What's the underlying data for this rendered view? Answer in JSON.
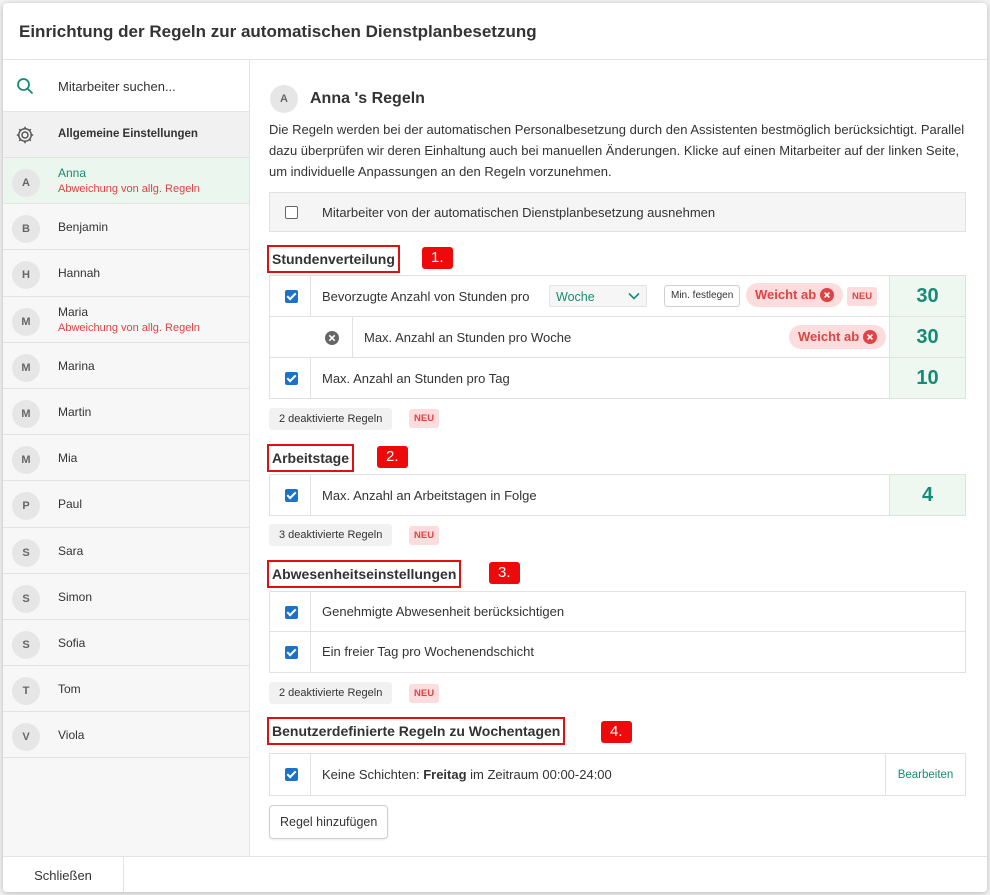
{
  "dialog": {
    "title": "Einrichtung der Regeln zur automatischen Dienstplanbesetzung"
  },
  "sidebar": {
    "search_placeholder": "Mitarbeiter suchen...",
    "settings_label": "Allgemeine Einstellungen",
    "employees": [
      {
        "initial": "A",
        "name": "Anna",
        "sub": "Abweichung von allg. Regeln",
        "active": true
      },
      {
        "initial": "B",
        "name": "Benjamin",
        "sub": ""
      },
      {
        "initial": "H",
        "name": "Hannah",
        "sub": ""
      },
      {
        "initial": "M",
        "name": "Maria",
        "sub": "Abweichung von allg. Regeln"
      },
      {
        "initial": "M",
        "name": "Marina",
        "sub": ""
      },
      {
        "initial": "M",
        "name": "Martin",
        "sub": ""
      },
      {
        "initial": "M",
        "name": "Mia",
        "sub": ""
      },
      {
        "initial": "P",
        "name": "Paul",
        "sub": ""
      },
      {
        "initial": "S",
        "name": "Sara",
        "sub": ""
      },
      {
        "initial": "S",
        "name": "Simon",
        "sub": ""
      },
      {
        "initial": "S",
        "name": "Sofia",
        "sub": ""
      },
      {
        "initial": "T",
        "name": "Tom",
        "sub": ""
      },
      {
        "initial": "V",
        "name": "Viola",
        "sub": ""
      }
    ]
  },
  "main": {
    "avatar": "A",
    "title": "Anna 's Regeln",
    "description": "Die Regeln werden bei der automatischen Personalbesetzung durch den Assistenten bestmöglich berücksichtigt. Parallel dazu überprüfen wir deren Einhaltung auch bei manuellen Änderungen. Klicke auf einen Mitarbeiter auf der linken Seite, um individuelle Anpassungen an den Regeln vorzunehmen.",
    "exclude_label": "Mitarbeiter von der automatischen Dienstplanbesetzung ausnehmen",
    "sections": {
      "stunden": {
        "title": "Stundenverteilung",
        "marker": "1.",
        "row1": {
          "label": "Bevorzugte Anzahl von Stunden pro",
          "select": "Woche",
          "min_button": "Min. festlegen",
          "pill": "Weicht ab",
          "neu": "NEU",
          "value": "30"
        },
        "row2": {
          "label": "Max. Anzahl an Stunden pro Woche",
          "pill": "Weicht ab",
          "value": "30"
        },
        "row3": {
          "label": "Max. Anzahl an Stunden pro Tag",
          "value": "10"
        },
        "deactivated": "2 deaktivierte Regeln",
        "neu": "NEU"
      },
      "arbeitstage": {
        "title": "Arbeitstage",
        "marker": "2.",
        "row1": {
          "label": "Max. Anzahl an Arbeitstagen in Folge",
          "value": "4"
        },
        "deactivated": "3 deaktivierte Regeln",
        "neu": "NEU"
      },
      "abwesenheit": {
        "title": "Abwesenheitseinstellungen",
        "marker": "3.",
        "row1": {
          "label": "Genehmigte Abwesenheit berücksichtigen"
        },
        "row2": {
          "label": "Ein freier Tag pro Wochenendschicht"
        },
        "deactivated": "2 deaktivierte Regeln",
        "neu": "NEU"
      },
      "custom": {
        "title": "Benutzerdefinierte Regeln zu Wochentagen",
        "marker": "4.",
        "row1": {
          "prefix": "Keine Schichten: ",
          "bold": "Freitag",
          "suffix": " im Zeitraum 00:00-24:00",
          "edit": "Bearbeiten"
        }
      }
    },
    "add_button": "Regel hinzufügen"
  },
  "footer": {
    "close_label": "Schließen"
  },
  "colors": {
    "accent": "#168b76",
    "checkbox": "#1b73c9",
    "danger": "#e04343",
    "marker": "#ee0a0a"
  }
}
